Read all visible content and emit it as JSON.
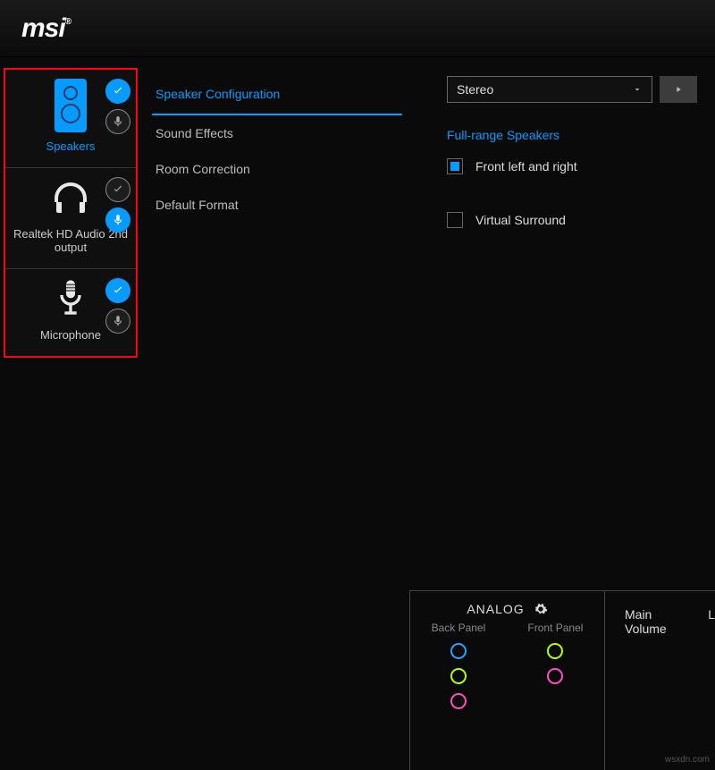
{
  "brand": "msi",
  "devices": [
    {
      "id": "speakers",
      "label": "Speakers",
      "active": true,
      "check": "blue",
      "mic": "grey"
    },
    {
      "id": "realtek2nd",
      "label": "Realtek HD Audio 2nd output",
      "active": false,
      "check": "grey",
      "mic": "blue"
    },
    {
      "id": "microphone",
      "label": "Microphone",
      "active": false,
      "check": "blue",
      "mic": "grey"
    }
  ],
  "tabs": [
    {
      "id": "speaker-config",
      "label": "Speaker Configuration",
      "active": true
    },
    {
      "id": "sound-effects",
      "label": "Sound Effects",
      "active": false
    },
    {
      "id": "room-correction",
      "label": "Room Correction",
      "active": false
    },
    {
      "id": "default-format",
      "label": "Default Format",
      "active": false
    }
  ],
  "config": {
    "select_value": "Stereo",
    "section_title": "Full-range Speakers",
    "front_lr_label": "Front left and right",
    "front_lr_checked": true,
    "virtual_surround_label": "Virtual Surround",
    "virtual_surround_checked": false
  },
  "analog": {
    "title": "ANALOG",
    "back_label": "Back Panel",
    "front_label": "Front Panel",
    "back_jacks": [
      "#2aa3ff",
      "#b4ff00",
      "#ff4fbf"
    ],
    "front_jacks": [
      "#b4ff00",
      "#ff4fbf"
    ]
  },
  "volume": {
    "title": "Main Volume",
    "channel_label": "L"
  },
  "watermark": "wsxdn.com"
}
